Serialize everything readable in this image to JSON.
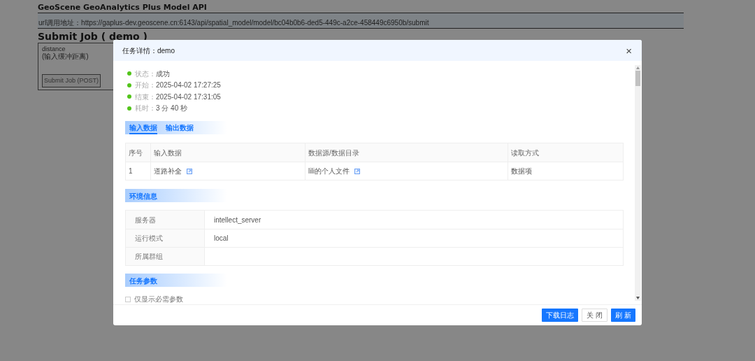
{
  "page": {
    "title": "GeoScene GeoAnalytics Plus Model API",
    "url": "url调用地址：https://gaplus-dev.geoscene.cn:6143/api/spatial_model/model/bc04b0b6-ded5-449c-a2ce-458449c6950b/submit",
    "heading": "Submit Job ( demo )",
    "param_name": "distance",
    "param_hint": "(输入缓冲距离)",
    "submit_button": "Submit Job (POST)"
  },
  "dialog": {
    "title": "任务详情：demo",
    "close": "×",
    "status": [
      {
        "label": "状态：",
        "value": "成功",
        "color": "#52c41a"
      },
      {
        "label": "开始：",
        "value": "2025-04-02 17:27:25",
        "color": "#52c41a"
      },
      {
        "label": "结束：",
        "value": "2025-04-02 17:31:05",
        "color": "#52c41a"
      },
      {
        "label": "耗时：",
        "value": "3 分 40 秒",
        "color": "#52c41a"
      }
    ],
    "tabs": [
      {
        "label": "输入数据",
        "selected": true
      },
      {
        "label": "输出数据",
        "selected": false
      }
    ],
    "data_table": {
      "columns": [
        "序号",
        "输入数据",
        "数据源/数据目录",
        "读取方式"
      ],
      "rows": [
        [
          {
            "text": "1",
            "linked": false
          },
          {
            "text": "道路补全",
            "linked": true
          },
          {
            "text": "lili的个人文件",
            "linked": true
          },
          {
            "text": "数据项",
            "linked": false
          }
        ]
      ]
    },
    "env_title": "环境信息",
    "env": [
      {
        "label": "服务器",
        "value": "intellect_server"
      },
      {
        "label": "运行模式",
        "value": "local"
      },
      {
        "label": "所属群组"
      }
    ],
    "params_title": "任务参数",
    "required_only": {
      "label": "仅显示必需参数",
      "checked": false
    },
    "buttons": [
      {
        "label": "下载日志",
        "kind": "primary"
      },
      {
        "label": "关 闭",
        "kind": "default"
      },
      {
        "label": "刷 新",
        "kind": "primary"
      }
    ]
  }
}
